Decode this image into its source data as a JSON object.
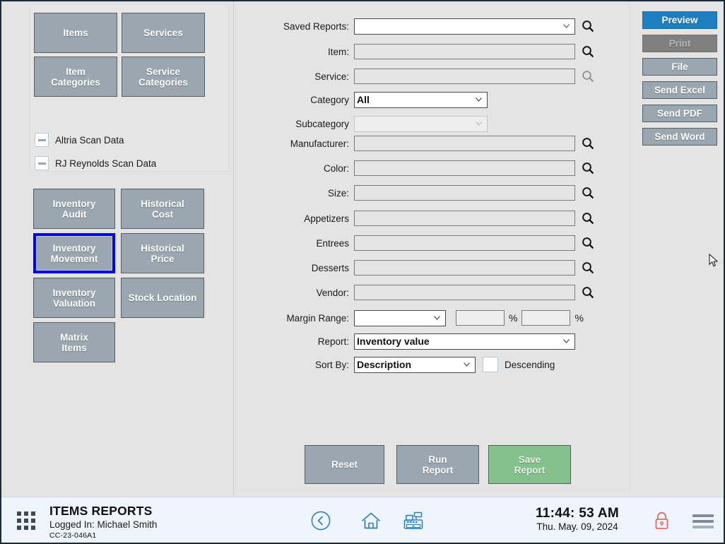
{
  "sidebar": {
    "entity_tiles": [
      {
        "label": "Items",
        "name": "items"
      },
      {
        "label": "Services",
        "name": "services"
      },
      {
        "label": "Item\nCategories",
        "name": "item-categories"
      },
      {
        "label": "Service\nCategories",
        "name": "service-categories"
      }
    ],
    "scan_data": [
      {
        "label": "Altria Scan Data",
        "state": "indeterminate"
      },
      {
        "label": "RJ Reynolds Scan Data",
        "state": "indeterminate"
      }
    ],
    "report_tiles": [
      {
        "label": "Inventory\nAudit",
        "name": "inventory-audit",
        "selected": false
      },
      {
        "label": "Historical\nCost",
        "name": "historical-cost",
        "selected": false
      },
      {
        "label": "Inventory\nMovement",
        "name": "inventory-movement",
        "selected": true
      },
      {
        "label": "Historical\nPrice",
        "name": "historical-price",
        "selected": false
      },
      {
        "label": "Inventory\nValuation",
        "name": "inventory-valuation",
        "selected": false
      },
      {
        "label": "Stock Location",
        "name": "stock-location",
        "selected": false
      },
      {
        "label": "Matrix\nItems",
        "name": "matrix-items",
        "selected": false
      }
    ]
  },
  "form": {
    "saved_reports": {
      "label": "Saved Reports:",
      "value": "",
      "enabled": true,
      "search": true
    },
    "item": {
      "label": "Item:",
      "value": "",
      "enabled": true,
      "search": true
    },
    "service": {
      "label": "Service:",
      "value": "",
      "enabled": false,
      "search": false
    },
    "category": {
      "label": "Category",
      "value": "All",
      "enabled": true
    },
    "subcategory": {
      "label": "Subcategory",
      "value": "",
      "enabled": false
    },
    "manufacturer": {
      "label": "Manufacturer:",
      "value": "",
      "enabled": true,
      "search": true
    },
    "color": {
      "label": "Color:",
      "value": "",
      "enabled": true,
      "search": true
    },
    "size": {
      "label": "Size:",
      "value": "",
      "enabled": true,
      "search": true
    },
    "appetizers": {
      "label": "Appetizers",
      "value": "",
      "enabled": true,
      "search": true
    },
    "entrees": {
      "label": "Entrees",
      "value": "",
      "enabled": true,
      "search": true
    },
    "desserts": {
      "label": "Desserts",
      "value": "",
      "enabled": true,
      "search": true
    },
    "vendor": {
      "label": "Vendor:",
      "value": "",
      "enabled": true,
      "search": true
    },
    "margin_range": {
      "label": "Margin Range:",
      "operator": "",
      "from": "",
      "to": "",
      "unit_from": "%",
      "unit_to": "%"
    },
    "report": {
      "label": "Report:",
      "value": "Inventory value"
    },
    "sort_by": {
      "label": "Sort By:",
      "value": "Description"
    },
    "descending": {
      "label": "Descending",
      "checked": false
    }
  },
  "actions": {
    "reset": "Reset",
    "run_report": "Run\nReport",
    "save_report": "Save\nReport"
  },
  "output_buttons": [
    {
      "label": "Preview",
      "name": "preview",
      "state": "primary"
    },
    {
      "label": "Print",
      "name": "print",
      "state": "disabled"
    },
    {
      "label": "File",
      "name": "file",
      "state": "normal"
    },
    {
      "label": "Send Excel",
      "name": "send-excel",
      "state": "normal"
    },
    {
      "label": "Send PDF",
      "name": "send-pdf",
      "state": "normal"
    },
    {
      "label": "Send Word",
      "name": "send-word",
      "state": "normal"
    }
  ],
  "statusbar": {
    "title": "ITEMS REPORTS",
    "logged_in": "Logged In:  Michael Smith",
    "version_code": "CC-23-046A1",
    "time": "11:44: 53 AM",
    "date": "Thu. May. 09, 2024",
    "icons": [
      "apps-grid-icon",
      "back-icon",
      "home-icon",
      "cash-register-icon",
      "lock-icon",
      "hamburger-menu-icon"
    ]
  },
  "colors": {
    "accent_primary": "#1f7ec0",
    "tile": "#9aa7b0",
    "selection_outline": "#0000ff",
    "save_green": "#85c18d",
    "statusbar_bg": "#eef5fd",
    "lock_red": "#e06b6b"
  }
}
